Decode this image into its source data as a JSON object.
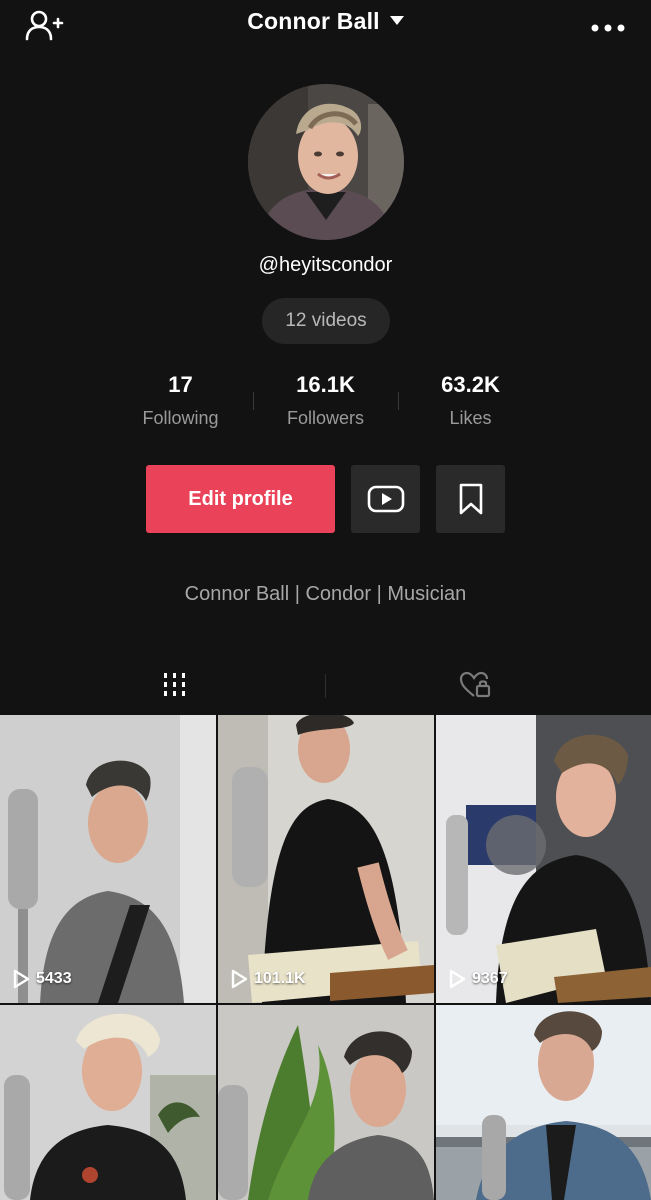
{
  "header": {
    "username": "Connor Ball",
    "icons": {
      "left": "add-user-icon",
      "dropdown": "caret-down-icon",
      "right": "more-icon"
    }
  },
  "profile": {
    "handle": "@heyitscondor",
    "videos_pill": "12 videos",
    "bio": "Connor Ball | Condor | Musician"
  },
  "stats": [
    {
      "value": "17",
      "label": "Following"
    },
    {
      "value": "16.1K",
      "label": "Followers"
    },
    {
      "value": "63.2K",
      "label": "Likes"
    }
  ],
  "actions": {
    "edit_profile_label": "Edit profile",
    "accent_color": "#ea4359",
    "icons": [
      "youtube-icon",
      "bookmark-icon"
    ]
  },
  "tabs": [
    {
      "icon": "grid-icon",
      "active": true
    },
    {
      "icon": "liked-private-icon",
      "active": false
    }
  ],
  "videos": [
    {
      "views": "5433"
    },
    {
      "views": "101.1K"
    },
    {
      "views": "9367"
    },
    {
      "views": ""
    },
    {
      "views": ""
    },
    {
      "views": ""
    }
  ]
}
